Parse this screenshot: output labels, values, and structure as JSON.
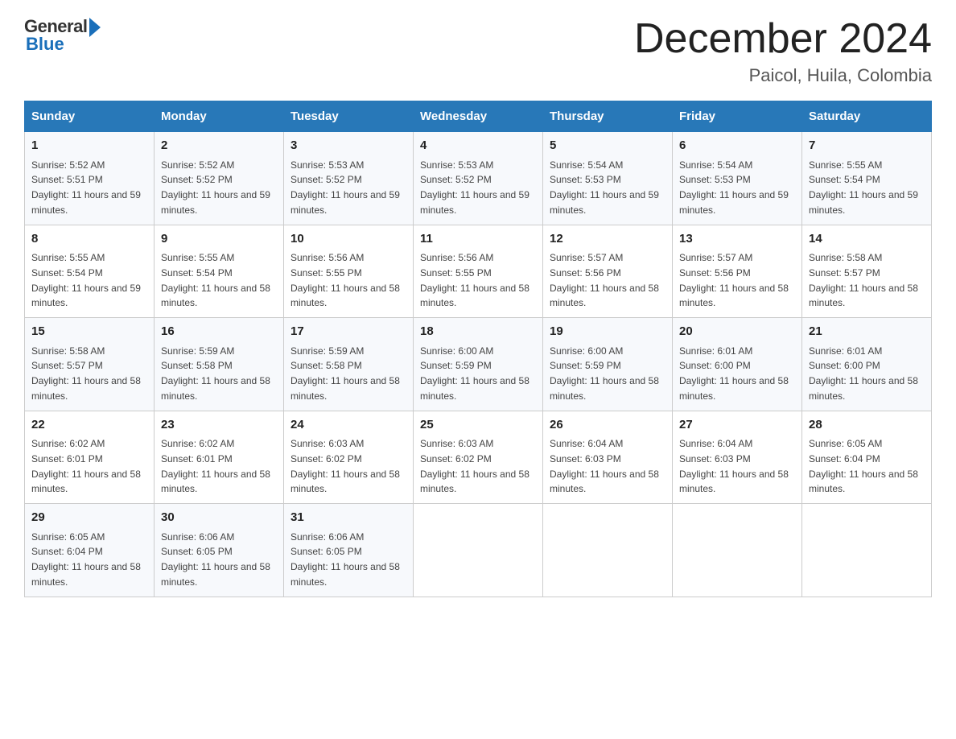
{
  "header": {
    "logo_general": "General",
    "logo_blue": "Blue",
    "title": "December 2024",
    "location": "Paicol, Huila, Colombia"
  },
  "days_of_week": [
    "Sunday",
    "Monday",
    "Tuesday",
    "Wednesday",
    "Thursday",
    "Friday",
    "Saturday"
  ],
  "weeks": [
    [
      {
        "day": "1",
        "sunrise": "5:52 AM",
        "sunset": "5:51 PM",
        "daylight": "11 hours and 59 minutes."
      },
      {
        "day": "2",
        "sunrise": "5:52 AM",
        "sunset": "5:52 PM",
        "daylight": "11 hours and 59 minutes."
      },
      {
        "day": "3",
        "sunrise": "5:53 AM",
        "sunset": "5:52 PM",
        "daylight": "11 hours and 59 minutes."
      },
      {
        "day": "4",
        "sunrise": "5:53 AM",
        "sunset": "5:52 PM",
        "daylight": "11 hours and 59 minutes."
      },
      {
        "day": "5",
        "sunrise": "5:54 AM",
        "sunset": "5:53 PM",
        "daylight": "11 hours and 59 minutes."
      },
      {
        "day": "6",
        "sunrise": "5:54 AM",
        "sunset": "5:53 PM",
        "daylight": "11 hours and 59 minutes."
      },
      {
        "day": "7",
        "sunrise": "5:55 AM",
        "sunset": "5:54 PM",
        "daylight": "11 hours and 59 minutes."
      }
    ],
    [
      {
        "day": "8",
        "sunrise": "5:55 AM",
        "sunset": "5:54 PM",
        "daylight": "11 hours and 59 minutes."
      },
      {
        "day": "9",
        "sunrise": "5:55 AM",
        "sunset": "5:54 PM",
        "daylight": "11 hours and 58 minutes."
      },
      {
        "day": "10",
        "sunrise": "5:56 AM",
        "sunset": "5:55 PM",
        "daylight": "11 hours and 58 minutes."
      },
      {
        "day": "11",
        "sunrise": "5:56 AM",
        "sunset": "5:55 PM",
        "daylight": "11 hours and 58 minutes."
      },
      {
        "day": "12",
        "sunrise": "5:57 AM",
        "sunset": "5:56 PM",
        "daylight": "11 hours and 58 minutes."
      },
      {
        "day": "13",
        "sunrise": "5:57 AM",
        "sunset": "5:56 PM",
        "daylight": "11 hours and 58 minutes."
      },
      {
        "day": "14",
        "sunrise": "5:58 AM",
        "sunset": "5:57 PM",
        "daylight": "11 hours and 58 minutes."
      }
    ],
    [
      {
        "day": "15",
        "sunrise": "5:58 AM",
        "sunset": "5:57 PM",
        "daylight": "11 hours and 58 minutes."
      },
      {
        "day": "16",
        "sunrise": "5:59 AM",
        "sunset": "5:58 PM",
        "daylight": "11 hours and 58 minutes."
      },
      {
        "day": "17",
        "sunrise": "5:59 AM",
        "sunset": "5:58 PM",
        "daylight": "11 hours and 58 minutes."
      },
      {
        "day": "18",
        "sunrise": "6:00 AM",
        "sunset": "5:59 PM",
        "daylight": "11 hours and 58 minutes."
      },
      {
        "day": "19",
        "sunrise": "6:00 AM",
        "sunset": "5:59 PM",
        "daylight": "11 hours and 58 minutes."
      },
      {
        "day": "20",
        "sunrise": "6:01 AM",
        "sunset": "6:00 PM",
        "daylight": "11 hours and 58 minutes."
      },
      {
        "day": "21",
        "sunrise": "6:01 AM",
        "sunset": "6:00 PM",
        "daylight": "11 hours and 58 minutes."
      }
    ],
    [
      {
        "day": "22",
        "sunrise": "6:02 AM",
        "sunset": "6:01 PM",
        "daylight": "11 hours and 58 minutes."
      },
      {
        "day": "23",
        "sunrise": "6:02 AM",
        "sunset": "6:01 PM",
        "daylight": "11 hours and 58 minutes."
      },
      {
        "day": "24",
        "sunrise": "6:03 AM",
        "sunset": "6:02 PM",
        "daylight": "11 hours and 58 minutes."
      },
      {
        "day": "25",
        "sunrise": "6:03 AM",
        "sunset": "6:02 PM",
        "daylight": "11 hours and 58 minutes."
      },
      {
        "day": "26",
        "sunrise": "6:04 AM",
        "sunset": "6:03 PM",
        "daylight": "11 hours and 58 minutes."
      },
      {
        "day": "27",
        "sunrise": "6:04 AM",
        "sunset": "6:03 PM",
        "daylight": "11 hours and 58 minutes."
      },
      {
        "day": "28",
        "sunrise": "6:05 AM",
        "sunset": "6:04 PM",
        "daylight": "11 hours and 58 minutes."
      }
    ],
    [
      {
        "day": "29",
        "sunrise": "6:05 AM",
        "sunset": "6:04 PM",
        "daylight": "11 hours and 58 minutes."
      },
      {
        "day": "30",
        "sunrise": "6:06 AM",
        "sunset": "6:05 PM",
        "daylight": "11 hours and 58 minutes."
      },
      {
        "day": "31",
        "sunrise": "6:06 AM",
        "sunset": "6:05 PM",
        "daylight": "11 hours and 58 minutes."
      },
      null,
      null,
      null,
      null
    ]
  ]
}
